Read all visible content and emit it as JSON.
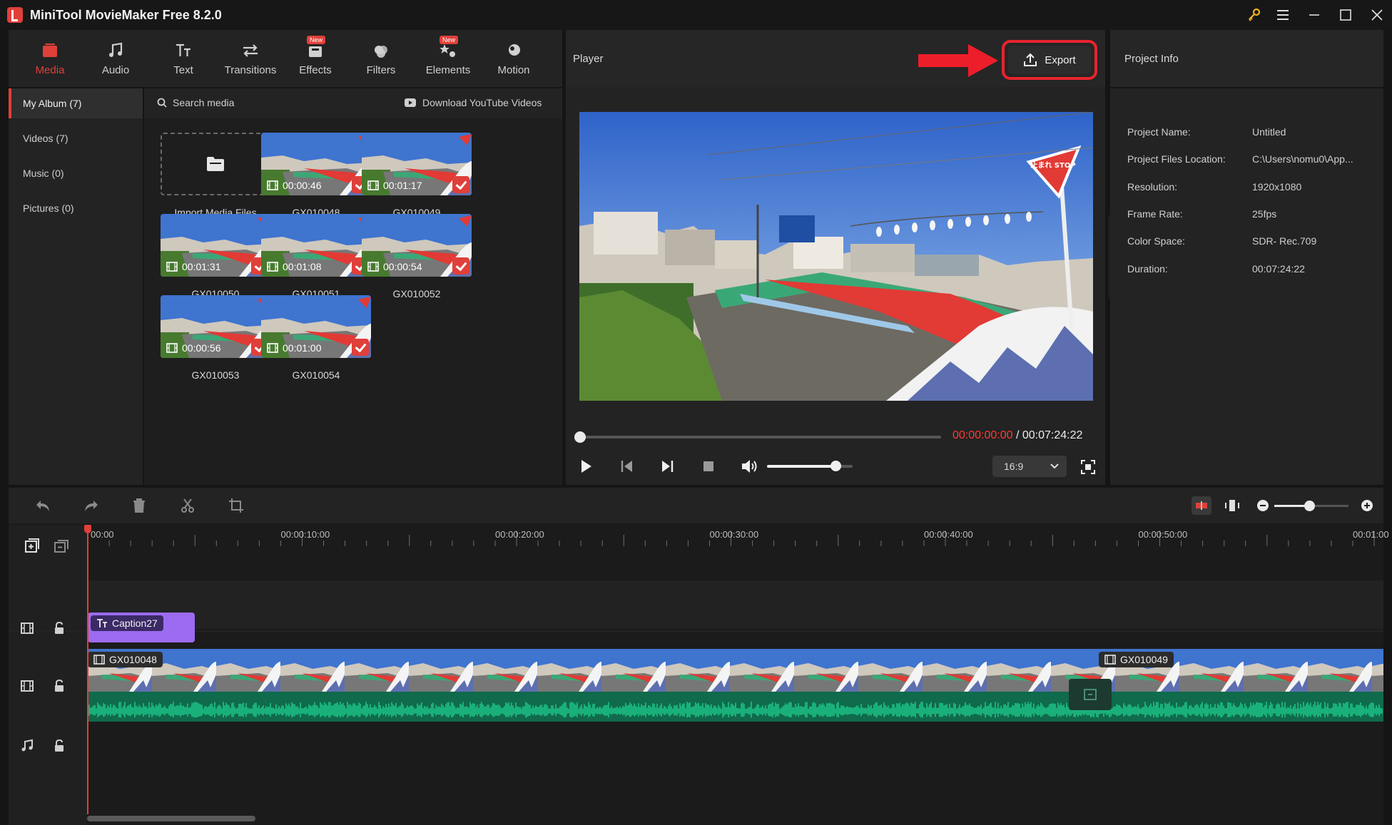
{
  "app": {
    "title": "MiniTool MovieMaker Free 8.2.0"
  },
  "colors": {
    "accent": "#e0403a",
    "bg": "#151515",
    "panel": "#232323",
    "caption": "#9b6cf0",
    "waveform": "#1db07a",
    "timecode_current": "#ff3b30"
  },
  "toolbar": {
    "items": [
      {
        "label": "Media",
        "icon": "media-icon",
        "active": true
      },
      {
        "label": "Audio",
        "icon": "music-note-icon"
      },
      {
        "label": "Text",
        "icon": "text-icon"
      },
      {
        "label": "Transitions",
        "icon": "transitions-icon"
      },
      {
        "label": "Effects",
        "icon": "effects-icon",
        "badge": "New"
      },
      {
        "label": "Filters",
        "icon": "filters-icon"
      },
      {
        "label": "Elements",
        "icon": "elements-icon",
        "badge": "New"
      },
      {
        "label": "Motion",
        "icon": "motion-icon"
      }
    ]
  },
  "sidebar": {
    "items": [
      {
        "label": "My Album (7)",
        "active": true
      },
      {
        "label": "Videos (7)"
      },
      {
        "label": "Music (0)"
      },
      {
        "label": "Pictures (0)"
      }
    ]
  },
  "media": {
    "search_placeholder": "Search media",
    "download_label": "Download YouTube Videos",
    "import_label": "Import Media Files",
    "items": [
      {
        "name": "GX010048",
        "duration": "00:00:46"
      },
      {
        "name": "GX010049",
        "duration": "00:01:17"
      },
      {
        "name": "GX010050",
        "duration": "00:01:31"
      },
      {
        "name": "GX010051",
        "duration": "00:01:08"
      },
      {
        "name": "GX010052",
        "duration": "00:00:54"
      },
      {
        "name": "GX010053",
        "duration": "00:00:56"
      },
      {
        "name": "GX010054",
        "duration": "00:01:00"
      }
    ]
  },
  "player": {
    "title": "Player",
    "export_label": "Export",
    "time_current": "00:00:00:00",
    "time_separator": " / ",
    "time_total": "00:07:24:22",
    "aspect_ratio": "16:9",
    "progress": 0,
    "volume": 1.0,
    "video_sign_text": "止まれ STOP"
  },
  "project_info": {
    "title": "Project Info",
    "rows": [
      {
        "key": "Project Name:",
        "value": "Untitled"
      },
      {
        "key": "Project Files Location:",
        "value": "C:\\Users\\nomu0\\App..."
      },
      {
        "key": "Resolution:",
        "value": "1920x1080"
      },
      {
        "key": "Frame Rate:",
        "value": "25fps"
      },
      {
        "key": "Color Space:",
        "value": "SDR- Rec.709"
      },
      {
        "key": "Duration:",
        "value": "00:07:24:22"
      }
    ]
  },
  "timeline": {
    "ruler_labels": [
      "00:00",
      "00:00:10:00",
      "00:00:20:00",
      "00:00:30:00",
      "00:00:40:00",
      "00:00:50:00",
      "00:01:00"
    ],
    "caption_clip": "Caption27",
    "video_clips": [
      "GX010048",
      "GX010049"
    ],
    "zoom": 0.47
  }
}
